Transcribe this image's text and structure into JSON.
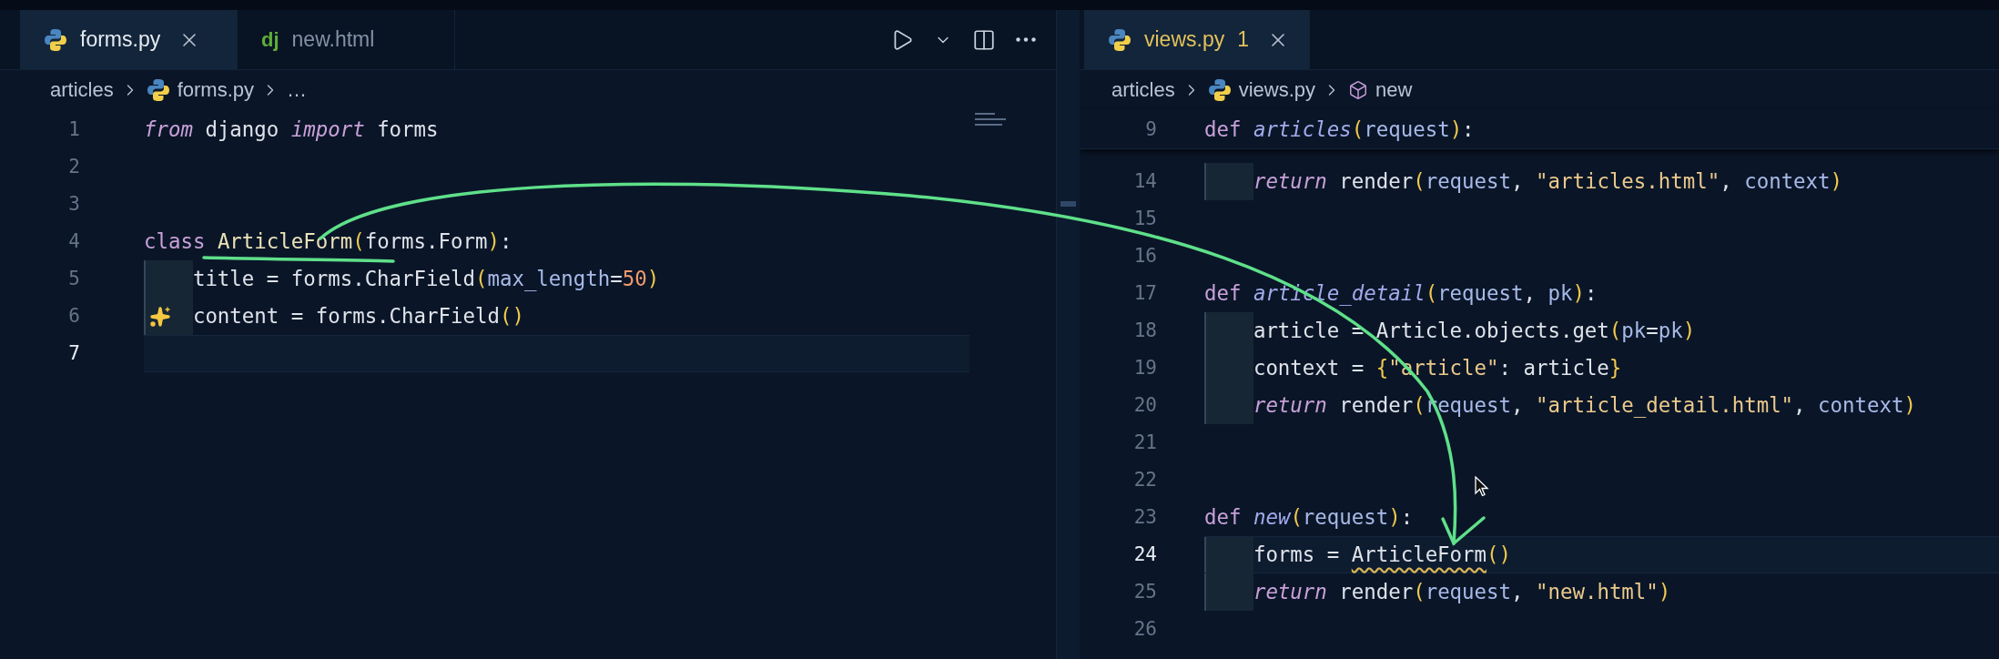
{
  "left_pane": {
    "tabs": [
      {
        "label": "forms.py",
        "kind": "python",
        "selected": true,
        "has_problems": false
      },
      {
        "label": "new.html",
        "kind": "django",
        "icon_text": "dj",
        "selected": false,
        "has_problems": false
      }
    ],
    "breadcrumb": [
      {
        "label": "articles",
        "kind": "folder"
      },
      {
        "label": "forms.py",
        "kind": "python"
      },
      {
        "label": "…",
        "kind": "more"
      }
    ],
    "lines": [
      {
        "number": "1",
        "current": false,
        "tokens": [
          {
            "text": "from",
            "kind": "kwi"
          },
          {
            "text": " django ",
            "kind": "plain"
          },
          {
            "text": "import",
            "kind": "kwi"
          },
          {
            "text": " forms",
            "kind": "plain"
          }
        ]
      },
      {
        "number": "2",
        "current": false
      },
      {
        "number": "3",
        "current": false
      },
      {
        "number": "4",
        "current": false,
        "tokens": [
          {
            "text": "class ",
            "kind": "kw"
          },
          {
            "text": "ArticleForm",
            "kind": "cls"
          },
          {
            "text": "(",
            "kind": "paren"
          },
          {
            "text": "forms.Form",
            "kind": "plain"
          },
          {
            "text": ")",
            "kind": "paren"
          },
          {
            "text": ":",
            "kind": "plain"
          }
        ]
      },
      {
        "number": "5",
        "current": false,
        "indented": true,
        "tokens": [
          {
            "text": "title = forms.CharField",
            "kind": "plain"
          },
          {
            "text": "(",
            "kind": "paren"
          },
          {
            "text": "max_length",
            "kind": "param"
          },
          {
            "text": "=",
            "kind": "plain"
          },
          {
            "text": "50",
            "kind": "num"
          },
          {
            "text": ")",
            "kind": "paren"
          }
        ]
      },
      {
        "number": "6",
        "current": false,
        "indented": true,
        "ai_hint": true,
        "tokens": [
          {
            "text": "content = forms.CharField",
            "kind": "plain"
          },
          {
            "text": "()",
            "kind": "paren"
          }
        ]
      },
      {
        "number": "7",
        "current": true
      }
    ]
  },
  "right_pane": {
    "tabs": [
      {
        "label": "views.py",
        "badge": "1",
        "kind": "python",
        "selected": true,
        "has_problems": true
      }
    ],
    "breadcrumb": [
      {
        "label": "articles",
        "kind": "folder"
      },
      {
        "label": "views.py",
        "kind": "python"
      },
      {
        "label": "new",
        "kind": "symbol"
      }
    ],
    "sticky_lines": [
      {
        "number": "9",
        "current": false,
        "tokens": [
          {
            "text": "def ",
            "kind": "kw"
          },
          {
            "text": "articles",
            "kind": "fn"
          },
          {
            "text": "(",
            "kind": "paren"
          },
          {
            "text": "request",
            "kind": "param"
          },
          {
            "text": ")",
            "kind": "paren"
          },
          {
            "text": ":",
            "kind": "plain"
          }
        ]
      }
    ],
    "lines": [
      {
        "number": "14",
        "current": false,
        "indented": true,
        "tokens": [
          {
            "text": "return",
            "kind": "kwi"
          },
          {
            "text": " render",
            "kind": "plain"
          },
          {
            "text": "(",
            "kind": "paren"
          },
          {
            "text": "request",
            "kind": "param"
          },
          {
            "text": ", ",
            "kind": "plain"
          },
          {
            "text": "\"articles.html\"",
            "kind": "str"
          },
          {
            "text": ", ",
            "kind": "plain"
          },
          {
            "text": "context",
            "kind": "param"
          },
          {
            "text": ")",
            "kind": "paren"
          }
        ]
      },
      {
        "number": "15",
        "current": false
      },
      {
        "number": "16",
        "current": false
      },
      {
        "number": "17",
        "current": false,
        "tokens": [
          {
            "text": "def ",
            "kind": "kw"
          },
          {
            "text": "article_detail",
            "kind": "fn"
          },
          {
            "text": "(",
            "kind": "paren"
          },
          {
            "text": "request",
            "kind": "param"
          },
          {
            "text": ", ",
            "kind": "plain"
          },
          {
            "text": "pk",
            "kind": "param"
          },
          {
            "text": ")",
            "kind": "paren"
          },
          {
            "text": ":",
            "kind": "plain"
          }
        ]
      },
      {
        "number": "18",
        "current": false,
        "indented": true,
        "tokens": [
          {
            "text": "article = Article.objects.get",
            "kind": "plain"
          },
          {
            "text": "(",
            "kind": "paren"
          },
          {
            "text": "pk",
            "kind": "param"
          },
          {
            "text": "=",
            "kind": "plain"
          },
          {
            "text": "pk",
            "kind": "param"
          },
          {
            "text": ")",
            "kind": "paren"
          }
        ]
      },
      {
        "number": "19",
        "current": false,
        "indented": true,
        "tokens": [
          {
            "text": "context = ",
            "kind": "plain"
          },
          {
            "text": "{",
            "kind": "paren"
          },
          {
            "text": "\"article\"",
            "kind": "str"
          },
          {
            "text": ": article",
            "kind": "plain"
          },
          {
            "text": "}",
            "kind": "paren"
          }
        ]
      },
      {
        "number": "20",
        "current": false,
        "indented": true,
        "tokens": [
          {
            "text": "return",
            "kind": "kwi"
          },
          {
            "text": " render",
            "kind": "plain"
          },
          {
            "text": "(",
            "kind": "paren"
          },
          {
            "text": "request",
            "kind": "param"
          },
          {
            "text": ", ",
            "kind": "plain"
          },
          {
            "text": "\"article_detail.html\"",
            "kind": "str"
          },
          {
            "text": ", ",
            "kind": "plain"
          },
          {
            "text": "context",
            "kind": "param"
          },
          {
            "text": ")",
            "kind": "paren"
          }
        ]
      },
      {
        "number": "21",
        "current": false
      },
      {
        "number": "22",
        "current": false
      },
      {
        "number": "23",
        "current": false,
        "tokens": [
          {
            "text": "def ",
            "kind": "kw"
          },
          {
            "text": "new",
            "kind": "fn"
          },
          {
            "text": "(",
            "kind": "paren"
          },
          {
            "text": "request",
            "kind": "param"
          },
          {
            "text": ")",
            "kind": "paren"
          },
          {
            "text": ":",
            "kind": "plain"
          }
        ]
      },
      {
        "number": "24",
        "current": true,
        "indented": true,
        "tokens": [
          {
            "text": "forms = ",
            "kind": "plain"
          },
          {
            "text": "ArticleForm",
            "kind": "warn"
          },
          {
            "text": "()",
            "kind": "paren"
          }
        ]
      },
      {
        "number": "25",
        "current": false,
        "indented": true,
        "tokens": [
          {
            "text": "return",
            "kind": "kwi"
          },
          {
            "text": " render",
            "kind": "plain"
          },
          {
            "text": "(",
            "kind": "paren"
          },
          {
            "text": "request",
            "kind": "param"
          },
          {
            "text": ", ",
            "kind": "plain"
          },
          {
            "text": "\"new.html\"",
            "kind": "str"
          },
          {
            "text": ")",
            "kind": "paren"
          }
        ]
      },
      {
        "number": "26",
        "current": false
      }
    ]
  }
}
